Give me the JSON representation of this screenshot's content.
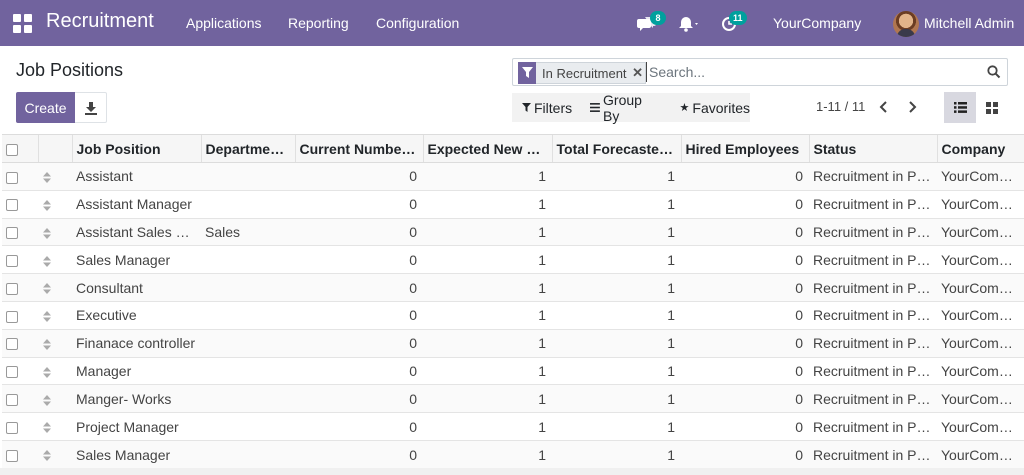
{
  "navbar": {
    "brand": "Recruitment",
    "menu": [
      "Applications",
      "Reporting",
      "Configuration"
    ],
    "messages_badge": "8",
    "activities_badge": "11",
    "company": "YourCompany",
    "user": "Mitchell Admin",
    "accent_color": "#71639e"
  },
  "control_panel": {
    "title": "Job Positions",
    "create_label": "Create",
    "facet_label": "In Recruitment",
    "search_placeholder": "Search...",
    "filters_label": "Filters",
    "groupby_label": "Group By",
    "favorites_label": "Favorites",
    "pager": "1-11 / 11"
  },
  "table": {
    "columns": [
      "Job Position",
      "Departmen…",
      "Current Number …",
      "Expected New E…",
      "Total Forecasted …",
      "Hired Employees",
      "Status",
      "Company"
    ],
    "rows": [
      {
        "name": "Assistant",
        "department": "",
        "current": "0",
        "expected": "1",
        "forecast": "1",
        "hired": "0",
        "status": "Recruitment in Pro…",
        "company": "YourCompany"
      },
      {
        "name": "Assistant Manager",
        "department": "",
        "current": "0",
        "expected": "1",
        "forecast": "1",
        "hired": "0",
        "status": "Recruitment in Pro…",
        "company": "YourCompany"
      },
      {
        "name": "Assistant Sales M…",
        "department": "Sales",
        "current": "0",
        "expected": "1",
        "forecast": "1",
        "hired": "0",
        "status": "Recruitment in Pro…",
        "company": "YourCompany"
      },
      {
        "name": "Sales Manager",
        "department": "",
        "current": "0",
        "expected": "1",
        "forecast": "1",
        "hired": "0",
        "status": "Recruitment in Pro…",
        "company": "YourCompany"
      },
      {
        "name": "Consultant",
        "department": "",
        "current": "0",
        "expected": "1",
        "forecast": "1",
        "hired": "0",
        "status": "Recruitment in Pro…",
        "company": "YourCompany"
      },
      {
        "name": "Executive",
        "department": "",
        "current": "0",
        "expected": "1",
        "forecast": "1",
        "hired": "0",
        "status": "Recruitment in Pro…",
        "company": "YourCompany"
      },
      {
        "name": "Finanace controller",
        "department": "",
        "current": "0",
        "expected": "1",
        "forecast": "1",
        "hired": "0",
        "status": "Recruitment in Pro…",
        "company": "YourCompany"
      },
      {
        "name": "Manager",
        "department": "",
        "current": "0",
        "expected": "1",
        "forecast": "1",
        "hired": "0",
        "status": "Recruitment in Pro…",
        "company": "YourCompany"
      },
      {
        "name": "Manger- Works",
        "department": "",
        "current": "0",
        "expected": "1",
        "forecast": "1",
        "hired": "0",
        "status": "Recruitment in Pro…",
        "company": "YourCompany"
      },
      {
        "name": "Project Manager",
        "department": "",
        "current": "0",
        "expected": "1",
        "forecast": "1",
        "hired": "0",
        "status": "Recruitment in Pro…",
        "company": "YourCompany"
      },
      {
        "name": "Sales Manager",
        "department": "",
        "current": "0",
        "expected": "1",
        "forecast": "1",
        "hired": "0",
        "status": "Recruitment in Pro…",
        "company": "YourCompany"
      }
    ]
  }
}
